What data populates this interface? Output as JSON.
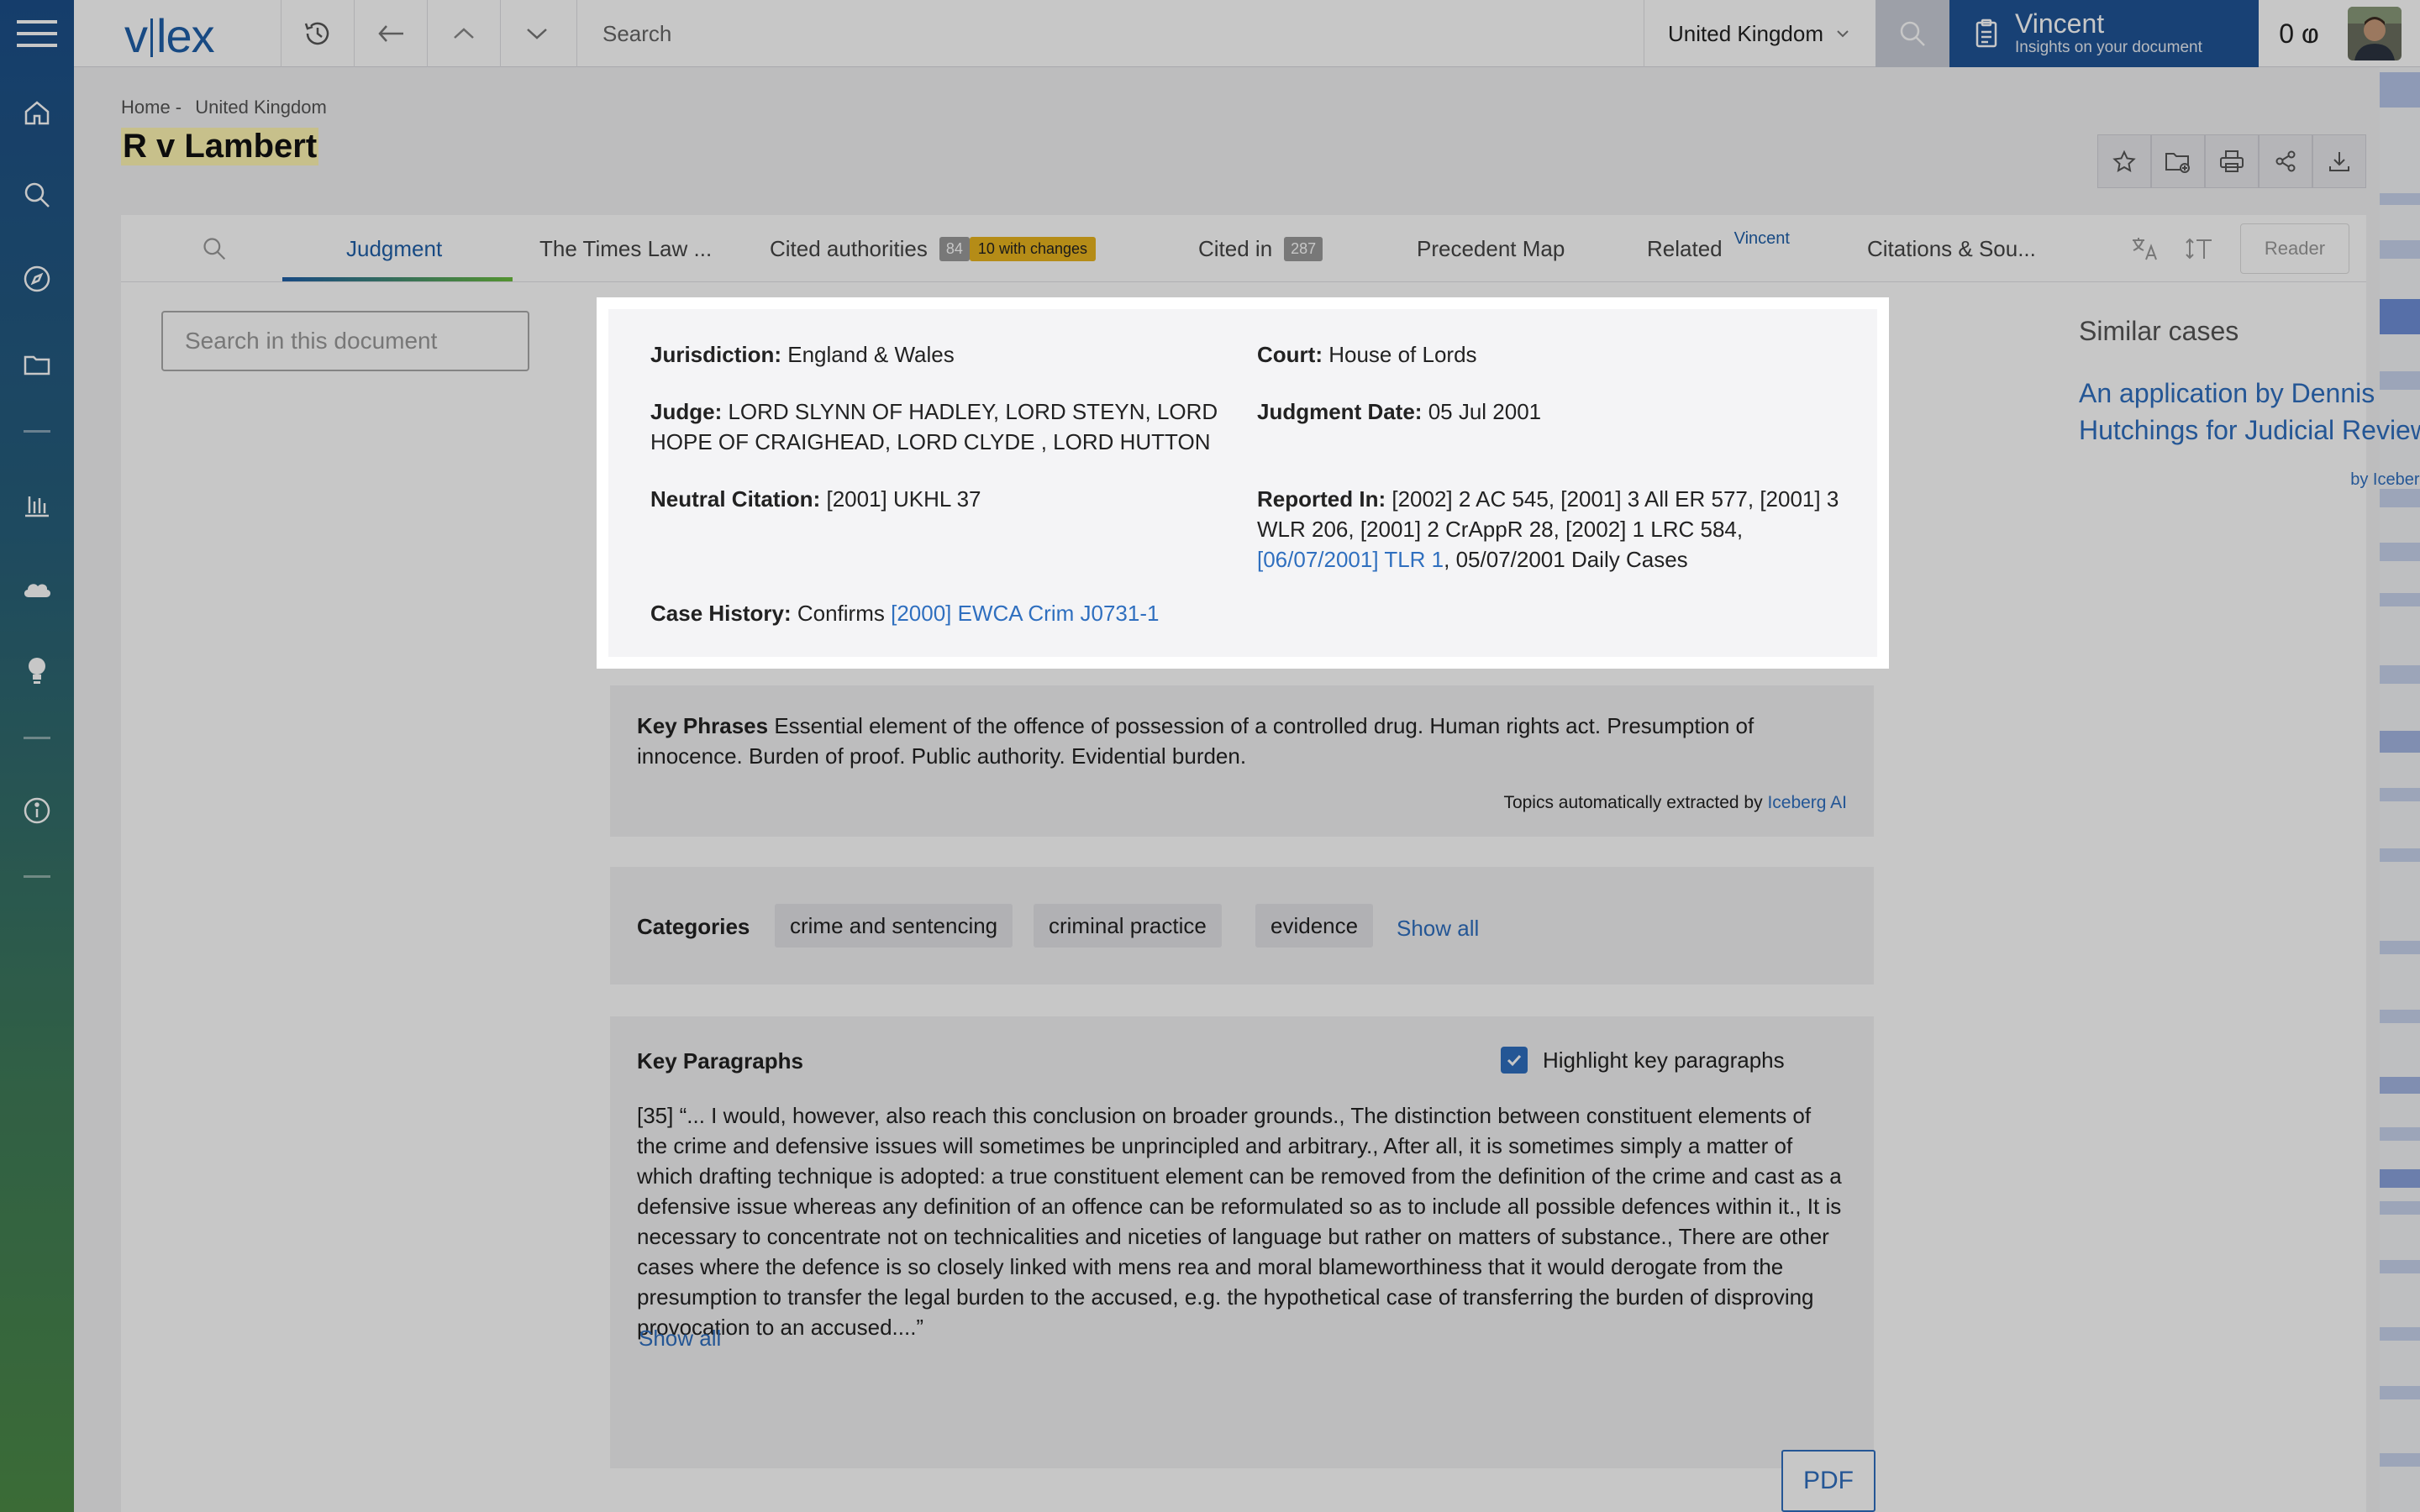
{
  "app": {
    "logo_left": "v",
    "logo_right": "lex"
  },
  "topbar": {
    "search_placeholder": "Search",
    "country": "United Kingdom",
    "assistant_name": "Vincent",
    "assistant_subtitle": "Insights on your document",
    "credits": "0 ⱷ"
  },
  "breadcrumb": {
    "home": "Home -",
    "country": "United Kingdom"
  },
  "document": {
    "title": "R v Lambert"
  },
  "tabs": {
    "judgment": "Judgment",
    "times_law": "The Times Law ...",
    "cited_authorities": "Cited authorities",
    "cited_authorities_count": "84",
    "cited_authorities_changes": "10 with changes",
    "cited_in": "Cited in",
    "cited_in_count": "287",
    "precedent_map": "Precedent Map",
    "related": "Related",
    "related_sup": "Vincent",
    "citations": "Citations & Sou...",
    "reader": "Reader"
  },
  "doc_search_placeholder": "Search in this document",
  "info": {
    "jurisdiction_label": "Jurisdiction:",
    "jurisdiction": "England & Wales",
    "court_label": "Court:",
    "court": "House of Lords",
    "judge_label": "Judge:",
    "judge": "LORD SLYNN OF HADLEY, LORD STEYN, LORD HOPE OF CRAIGHEAD, LORD CLYDE , LORD HUTTON",
    "judgment_date_label": "Judgment Date:",
    "judgment_date": "05 Jul 2001",
    "neutral_citation_label": "Neutral Citation:",
    "neutral_citation": "[2001] UKHL 37",
    "reported_in_label": "Reported In:",
    "reported_in": "[2002] 2 AC 545, [2001] 3 All ER 577, [2001] 3 WLR 206, [2001] 2 CrAppR 28, [2002] 1 LRC 584,",
    "reported_in_link": "[06/07/2001] TLR 1",
    "reported_in_tail": ", 05/07/2001 Daily Cases",
    "case_history_label": "Case History:",
    "case_history_prefix": "Confirms",
    "case_history_link": "[2000] EWCA Crim J0731-1"
  },
  "key_phrases": {
    "label": "Key Phrases",
    "text": "Essential element of the offence of possession of a controlled drug. Human rights act. Presumption of innocence. Burden of proof. Public authority. Evidential burden.",
    "footer_prefix": "Topics automatically extracted by",
    "footer_link": "Iceberg AI"
  },
  "categories": {
    "label": "Categories",
    "items": [
      "crime and sentencing",
      "criminal practice",
      "evidence"
    ],
    "show_all": "Show all"
  },
  "key_paragraphs": {
    "title": "Key Paragraphs",
    "highlight_label": "Highlight key paragraphs",
    "highlight_checked": true,
    "text": "[35] “... I would, however, also reach this conclusion on broader grounds., The distinction between constituent elements of the crime and defensive issues will sometimes be unprincipled and arbitrary., After all, it is sometimes simply a matter of which drafting technique is adopted: a true constituent element can be removed from the definition of the crime and cast as a defensive issue whereas any definition of an offence can be reformulated so as to include all possible defences within it., It is necessary to concentrate not on technicalities and niceties of language but rather on matters of substance., There are other cases where the defence is so closely linked with mens rea and moral blameworthiness that it would derogate from the presumption to transfer the legal burden to the accused, e.g. the hypothetical case of transferring the burden of disproving provocation to an accused....”",
    "show_all": "Show all"
  },
  "similar": {
    "heading": "Similar cases",
    "link": "An application by Dennis Hutchings for Judicial Review",
    "by": "by Iceberg AI"
  },
  "pdf_label": "PDF",
  "colors": {
    "brand": "#1f5fa8",
    "link": "#2f6fbf",
    "badge": "#e8b41e",
    "assistant_bg": "#1f5496"
  }
}
